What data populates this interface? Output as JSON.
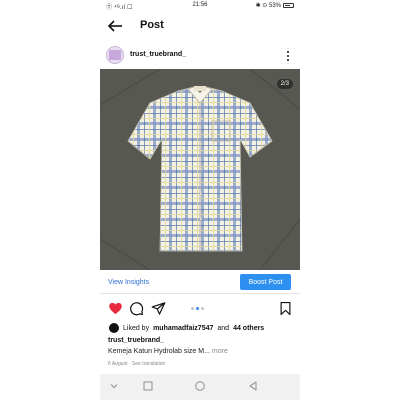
{
  "status_bar": {
    "carrier": "Ⓣ ⁴ᴳ.ıl ☐",
    "time": "21:56",
    "indicators": "✱ ⊙ 53%"
  },
  "top_bar": {
    "title": "Post",
    "back_icon": "arrow-left-icon"
  },
  "post_header": {
    "username": "trust_truebrand_",
    "more_icon": "vertical-ellipsis-icon"
  },
  "media": {
    "page_indicator": "2/3",
    "current_page": 2,
    "total_pages": 3,
    "image_subject": "short-sleeve plaid button-up shirt"
  },
  "insights_bar": {
    "view_insights_label": "View Insights",
    "boost_label": "Boost Post",
    "boost_color": "#2d8ff0",
    "link_color": "#2f6fd6"
  },
  "actions": {
    "like_icon": "heart-icon",
    "like_color": "#e8293f",
    "comment_icon": "comment-icon",
    "share_icon": "send-icon",
    "save_icon": "bookmark-icon",
    "carousel_active_index": 2,
    "carousel_dots": 3
  },
  "likes": {
    "prefix": "Liked by",
    "user": "muhamadfaiz7547",
    "connector": "and",
    "others": "44 others"
  },
  "caption": {
    "username": "trust_truebrand_",
    "text": "Kemeja Katun Hydrolab size M...",
    "more_label": "more"
  },
  "post_meta": {
    "date": "6 August",
    "separator": "·",
    "see_translation": "See translation"
  },
  "nav_bar": {
    "hide_icon": "chevron-down-icon",
    "recents_icon": "square-icon",
    "home_icon": "circle-icon",
    "back_icon": "triangle-left-icon"
  }
}
